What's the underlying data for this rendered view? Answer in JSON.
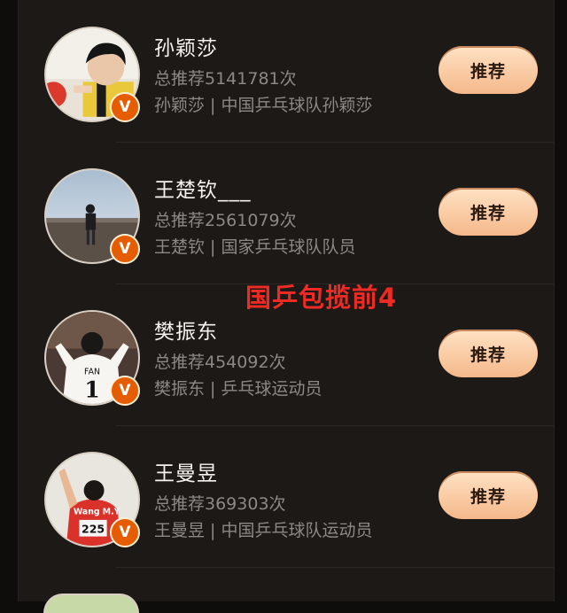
{
  "users": [
    {
      "name": "孙颖莎",
      "count": "总推荐5141781次",
      "desc": "孙颖莎 | 中国乒乓球队孙颖莎",
      "button": "推荐",
      "avatar_icon": "child-portrait-avatar",
      "badge": "V"
    },
    {
      "name": "王楚钦___",
      "count": "总推荐2561079次",
      "desc": "王楚钦 | 国家乒乓球队队员",
      "button": "推荐",
      "avatar_icon": "landscape-figure-avatar",
      "badge": "V"
    },
    {
      "name": "樊振东",
      "count": "总推荐454092次",
      "desc": "樊振东 | 乒乓球运动员",
      "button": "推荐",
      "avatar_icon": "jersey-back-avatar",
      "badge": "V"
    },
    {
      "name": "王曼昱",
      "count": "总推荐369303次",
      "desc": "王曼昱 | 中国乒乓球队运动员",
      "button": "推荐",
      "avatar_icon": "athlete-bib-avatar",
      "badge": "V"
    }
  ],
  "overlay_text": "国乒包揽前4",
  "jersey": {
    "name": "FAN",
    "number": "1"
  },
  "bib": {
    "name": "Wang M.Y",
    "number": "225"
  },
  "colors": {
    "background": "#1c1917",
    "button": "#f5b88a",
    "badge": "#e65c00",
    "overlay": "#ee2a24"
  }
}
